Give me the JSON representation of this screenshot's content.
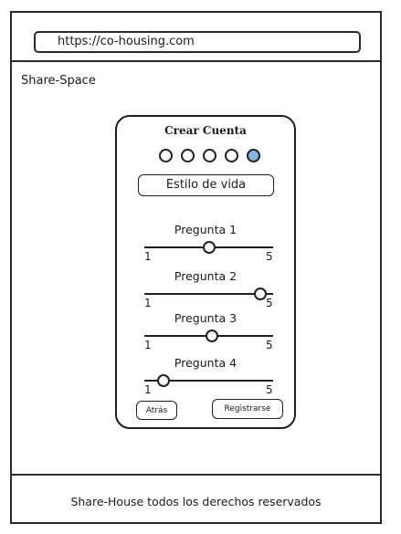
{
  "browser": {
    "url": "https://co-housing.com"
  },
  "site": {
    "name": "Share-Space"
  },
  "form": {
    "title": "Crear Cuenta",
    "steps": [
      {
        "active": false
      },
      {
        "active": false
      },
      {
        "active": false
      },
      {
        "active": false
      },
      {
        "active": true
      }
    ],
    "section_label": "Estilo de vida",
    "questions": [
      {
        "label": "Pregunta 1",
        "min": "1",
        "max": "5",
        "value": 3
      },
      {
        "label": "Pregunta 2",
        "min": "1",
        "max": "5",
        "value": 4.6
      },
      {
        "label": "Pregunta 3",
        "min": "1",
        "max": "5",
        "value": 3.1
      },
      {
        "label": "Pregunta 4",
        "min": "1",
        "max": "5",
        "value": 1.6
      }
    ],
    "back_label": "Atrás",
    "register_label": "Registrarse"
  },
  "footer": {
    "text": "Share-House todos los derechos reservados"
  },
  "colors": {
    "active_step": "#7fb8e6",
    "outline": "#1f1f1f"
  }
}
